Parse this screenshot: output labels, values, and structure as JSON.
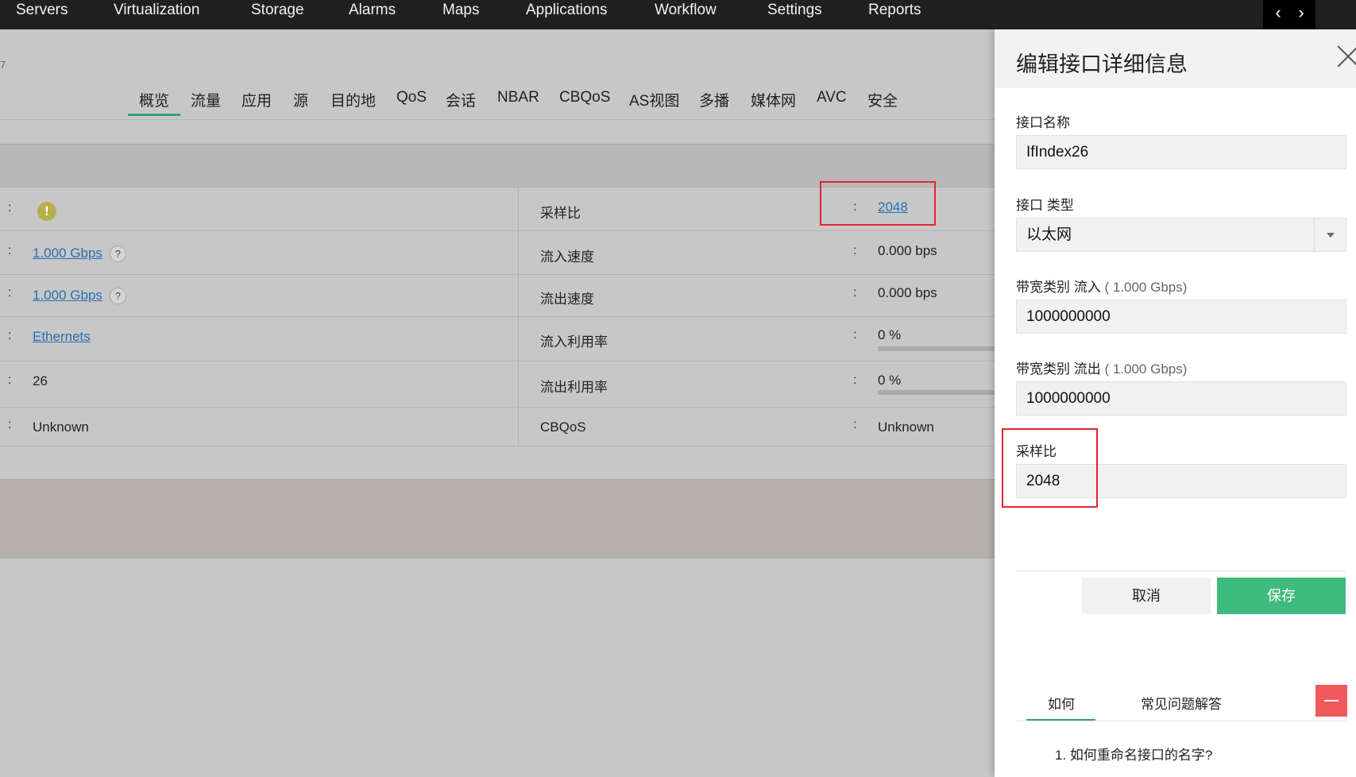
{
  "nav": {
    "items": [
      "Servers",
      "Virtualization",
      "Storage",
      "Alarms",
      "Maps",
      "Applications",
      "Workflow",
      "Settings",
      "Reports"
    ],
    "prev_icon": "chevron-left-icon",
    "next_icon": "chevron-right-icon"
  },
  "main": {
    "fragment": "7",
    "tabs": [
      "概览",
      "流量",
      "应用",
      "源",
      "目的地",
      "QoS",
      "会话",
      "NBAR",
      "CBQoS",
      "AS视图",
      "多播",
      "媒体网",
      "AVC",
      "安全"
    ],
    "active_tab": "概览",
    "rows": [
      {
        "left_colon": ":",
        "left_value": "",
        "left_icon": "warning-icon",
        "right_label": "采样比",
        "right_colon": ":",
        "right_value": "2048"
      },
      {
        "left_colon": ":",
        "left_value": "1.000 Gbps",
        "help": "?",
        "right_label": "流入速度",
        "right_colon": ":",
        "right_value": "0.000 bps"
      },
      {
        "left_colon": ":",
        "left_value": "1.000 Gbps",
        "help": "?",
        "right_label": "流出速度",
        "right_colon": ":",
        "right_value": "0.000 bps"
      },
      {
        "left_colon": ":",
        "left_value": "Ethernets",
        "right_label": "流入利用率",
        "right_colon": ":",
        "right_value": "0 %",
        "utilization": 0
      },
      {
        "left_colon": ":",
        "left_value": "26",
        "right_label": "流出利用率",
        "right_colon": ":",
        "right_value": "0 %",
        "utilization": 0
      },
      {
        "left_colon": ":",
        "left_value": "Unknown",
        "right_label": "CBQoS",
        "right_colon": ":",
        "right_value": "Unknown"
      }
    ]
  },
  "panel": {
    "title": "编辑接口详细信息",
    "close_icon": "close-icon",
    "fields": {
      "name": {
        "label": "接口名称",
        "value": "IfIndex26"
      },
      "type": {
        "label": "接口 类型",
        "value": "以太网"
      },
      "bw_in": {
        "label": "带宽类别 流入",
        "hint": " ( 1.000 Gbps)",
        "value": "1000000000"
      },
      "bw_out": {
        "label": "带宽类别 流出",
        "hint": " ( 1.000 Gbps)",
        "value": "1000000000"
      },
      "sampling": {
        "label": "采样比",
        "value": "2048"
      }
    },
    "cancel_label": "取消",
    "save_label": "保存",
    "help_tabs": [
      "如何",
      "常见问题解答"
    ],
    "active_help_tab": "如何",
    "faq_item": "1. 如何重命名接口的名字?"
  },
  "colors": {
    "accent_green": "#3fbb7d",
    "highlight_red": "#e0262a",
    "link_blue": "#2a6fb0",
    "minimize_red": "#f05a5b"
  }
}
